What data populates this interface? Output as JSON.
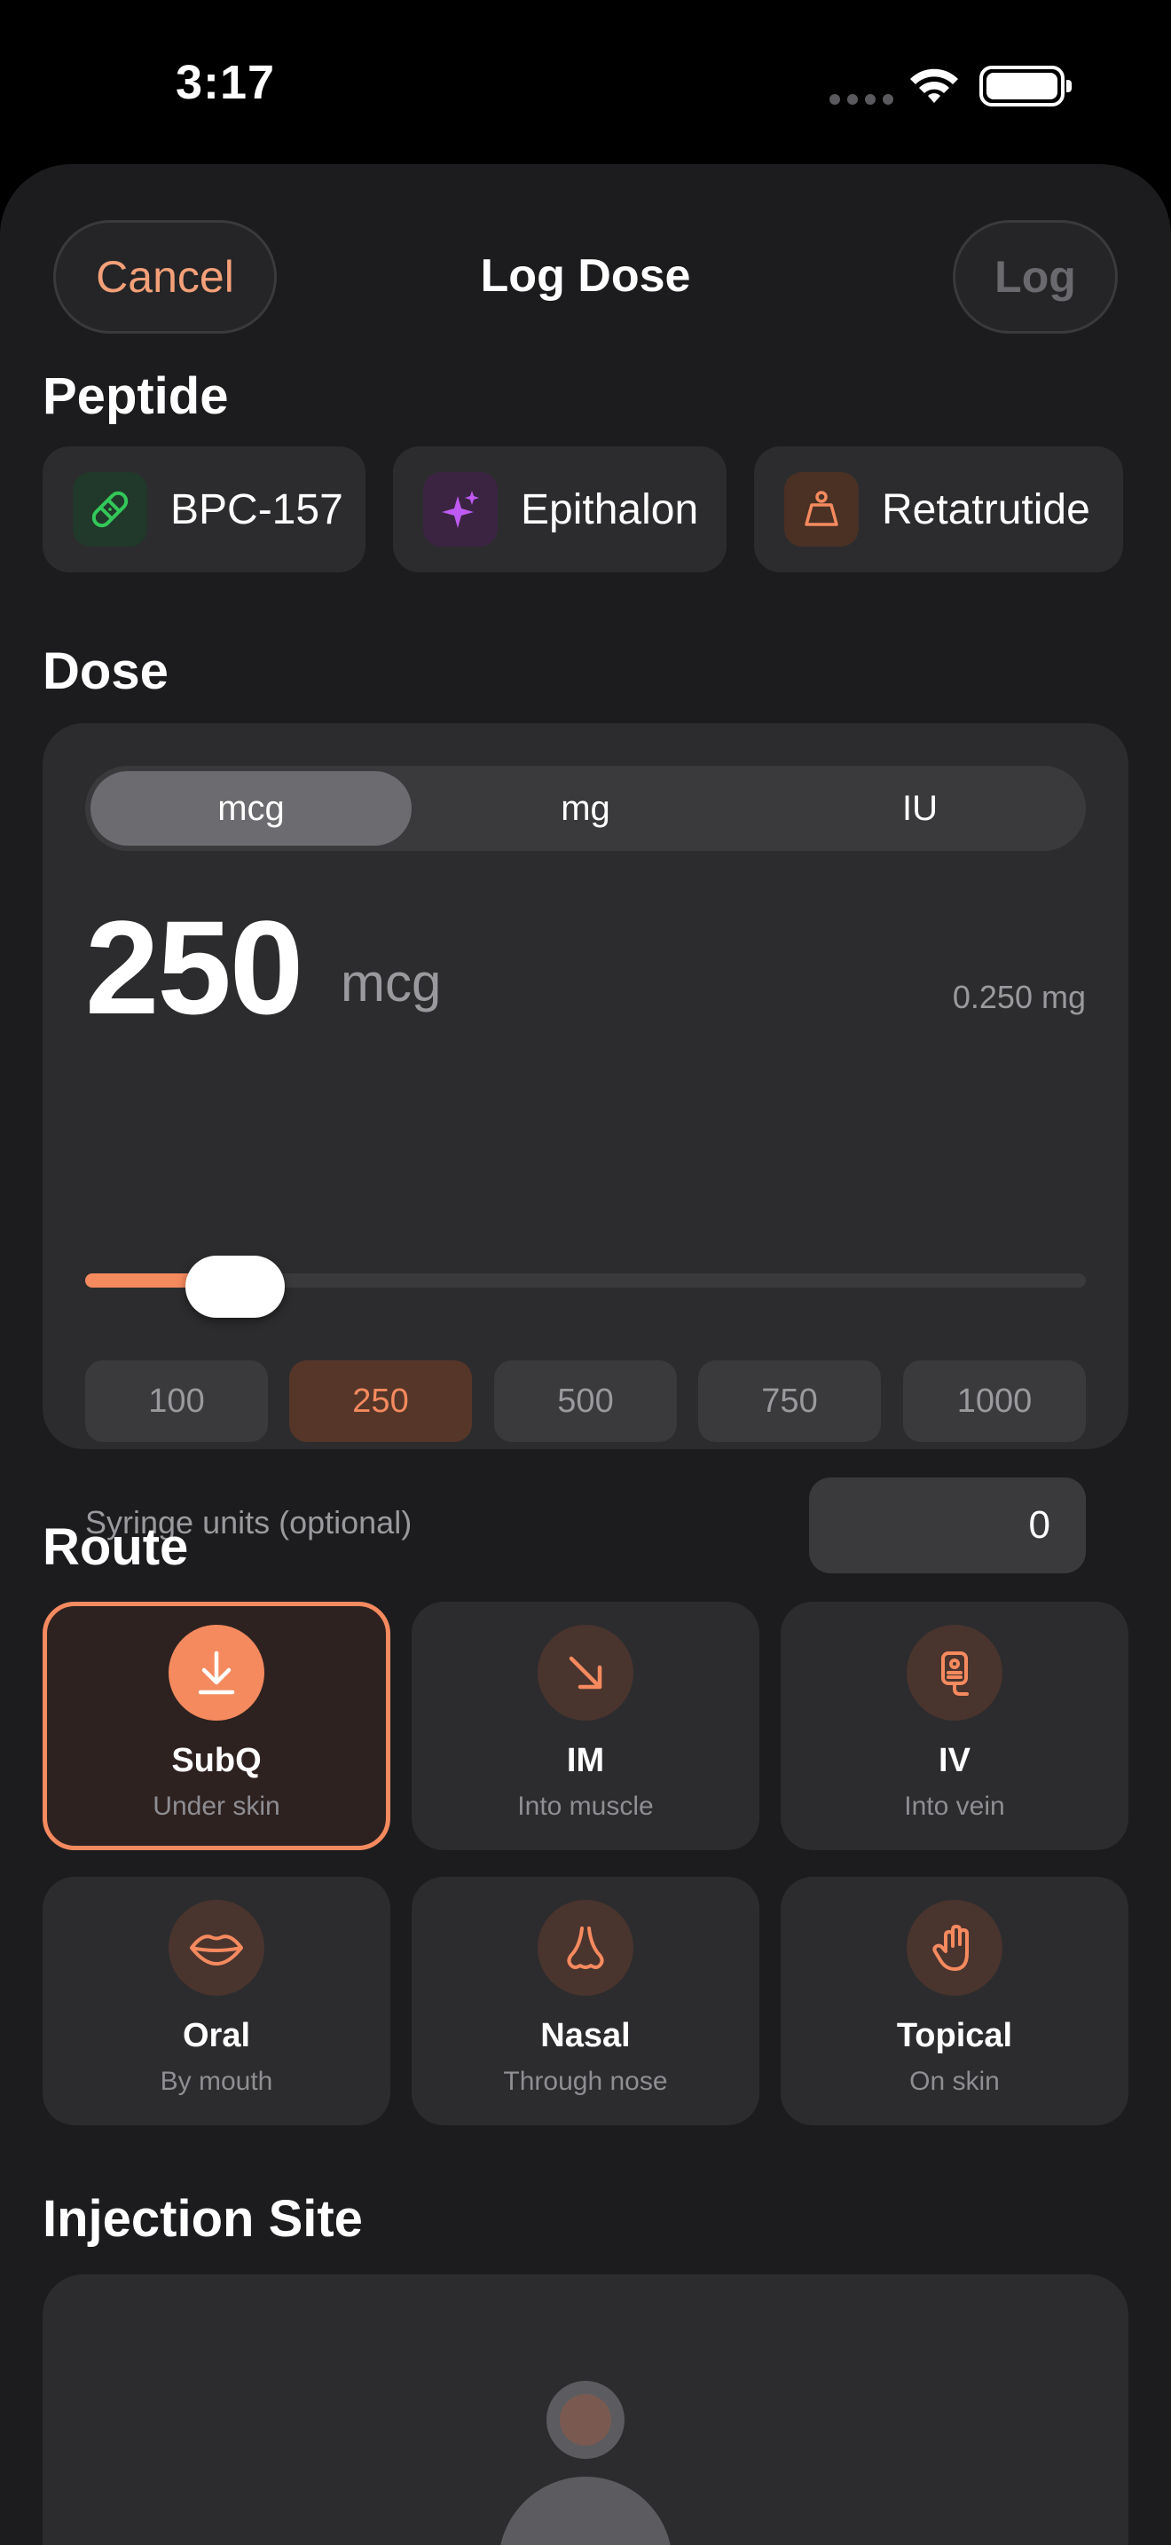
{
  "status_bar": {
    "time": "3:17"
  },
  "nav": {
    "cancel_label": "Cancel",
    "title": "Log Dose",
    "log_label": "Log"
  },
  "sections": {
    "peptide": "Peptide",
    "dose": "Dose",
    "route": "Route",
    "injection_site": "Injection Site"
  },
  "peptides": [
    {
      "label": "BPC-157",
      "icon": "bandage-icon",
      "icon_bg": "#20392a",
      "icon_color": "#34c759"
    },
    {
      "label": "Epithalon",
      "icon": "sparkles-icon",
      "icon_bg": "#3b2442",
      "icon_color": "#bf5af2"
    },
    {
      "label": "Retatrutide",
      "icon": "scale-weight-icon",
      "icon_bg": "#4a3124",
      "icon_color": "#f58a5f"
    }
  ],
  "dose": {
    "units": [
      "mcg",
      "mg",
      "IU"
    ],
    "selected_unit": "mcg",
    "value": "250",
    "unit_label": "mcg",
    "conversion": "0.250 mg",
    "slider_level_fraction": 0.15,
    "presets": [
      "100",
      "250",
      "500",
      "750",
      "1000"
    ],
    "selected_preset": "250",
    "syringe_label": "Syringe units (optional)",
    "syringe_value": "0"
  },
  "routes": [
    {
      "name": "SubQ",
      "sub": "Under skin",
      "icon": "arrow-down-to-line-icon",
      "selected": true
    },
    {
      "name": "IM",
      "sub": "Into muscle",
      "icon": "arrow-down-right-icon",
      "selected": false
    },
    {
      "name": "IV",
      "sub": "Into vein",
      "icon": "iv-bag-icon",
      "selected": false
    },
    {
      "name": "Oral",
      "sub": "By mouth",
      "icon": "lips-icon",
      "selected": false
    },
    {
      "name": "Nasal",
      "sub": "Through nose",
      "icon": "nose-icon",
      "selected": false
    },
    {
      "name": "Topical",
      "sub": "On skin",
      "icon": "hand-icon",
      "selected": false
    }
  ],
  "colors": {
    "accent": "#f58a5f",
    "background": "#1c1c1e",
    "card": "#2c2c2e"
  }
}
